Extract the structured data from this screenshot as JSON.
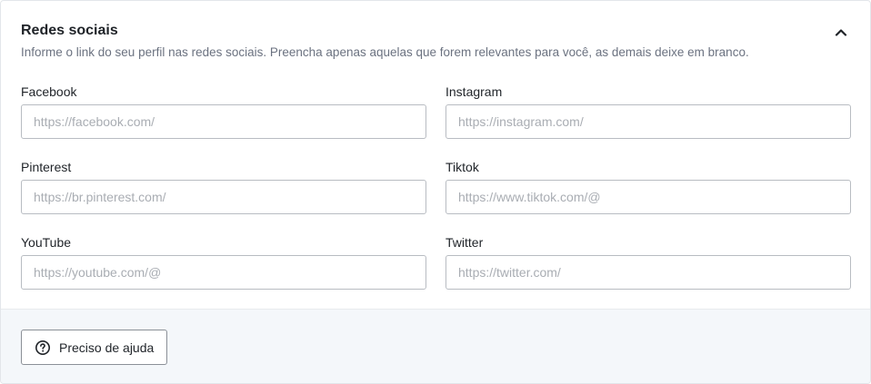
{
  "section": {
    "title": "Redes sociais",
    "description": "Informe o link do seu perfil nas redes sociais. Preencha apenas aquelas que forem relevantes para você, as demais deixe em branco."
  },
  "fields": [
    {
      "label": "Facebook",
      "placeholder": "https://facebook.com/",
      "value": ""
    },
    {
      "label": "Instagram",
      "placeholder": "https://instagram.com/",
      "value": ""
    },
    {
      "label": "Pinterest",
      "placeholder": "https://br.pinterest.com/",
      "value": ""
    },
    {
      "label": "Tiktok",
      "placeholder": "https://www.tiktok.com/@",
      "value": ""
    },
    {
      "label": "YouTube",
      "placeholder": "https://youtube.com/@",
      "value": ""
    },
    {
      "label": "Twitter",
      "placeholder": "https://twitter.com/",
      "value": ""
    }
  ],
  "footer": {
    "help_label": "Preciso de ajuda",
    "help_icon": "question-circle-icon"
  },
  "icons": {
    "collapse": "chevron-up-icon"
  },
  "colors": {
    "footer_bg": "#f4f7fa",
    "border": "#b8bcc2",
    "muted_text": "#6b7280"
  }
}
